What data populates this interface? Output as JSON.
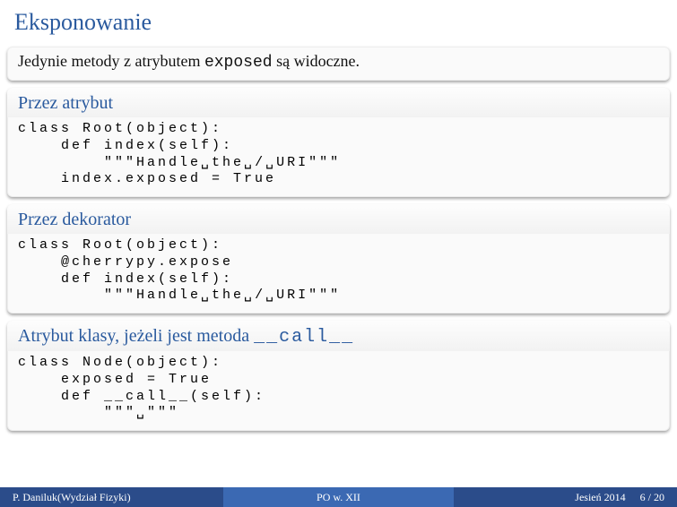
{
  "title": "Eksponowanie",
  "intro": {
    "text_before": "Jedynie metody z atrybutem ",
    "text_code": "exposed",
    "text_after": " są widoczne."
  },
  "block1": {
    "header": "Przez atrybut",
    "code": "class Root(object):\n    def index(self):\n        \"\"\"Handle␣the␣/␣URI\"\"\"\n    index.exposed = True"
  },
  "block2": {
    "header": "Przez dekorator",
    "code": "class Root(object):\n    @cherrypy.expose\n    def index(self):\n        \"\"\"Handle␣the␣/␣URI\"\"\""
  },
  "block3": {
    "header_before": "Atrybut klasy, jeżeli jest metoda ",
    "header_code": "__call__",
    "code": "class Node(object):\n    exposed = True\n    def __call__(self):\n        \"\"\"␣\"\"\""
  },
  "footer": {
    "author": "P. Daniluk(Wydział Fizyki)",
    "center": "PO w. XII",
    "term": "Jesień 2014",
    "page": "6 / 20"
  }
}
